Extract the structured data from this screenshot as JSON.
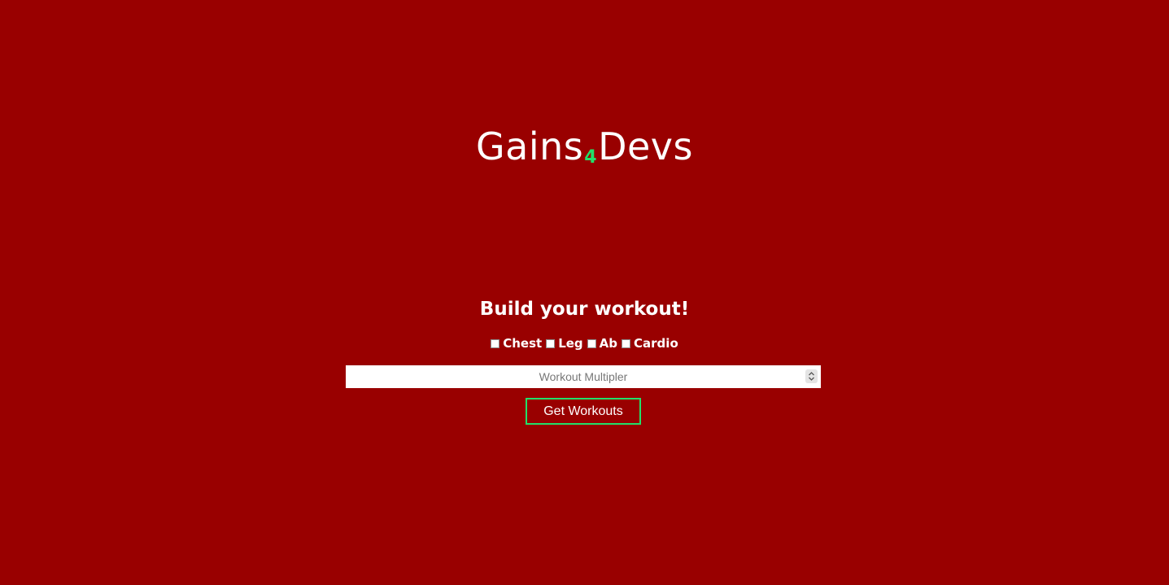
{
  "brand": {
    "part1": "Gains",
    "part2": "4",
    "part3": "Devs",
    "accent_color": "#22e06a",
    "background_color": "#990000"
  },
  "builder": {
    "heading": "Build your workout!",
    "options": [
      {
        "label": "Chest",
        "checked": false
      },
      {
        "label": "Leg",
        "checked": false
      },
      {
        "label": "Ab",
        "checked": false
      },
      {
        "label": "Cardio",
        "checked": false
      }
    ],
    "multiplier": {
      "placeholder": "Workout Multipler",
      "value": ""
    },
    "submit_label": "Get Workouts"
  }
}
